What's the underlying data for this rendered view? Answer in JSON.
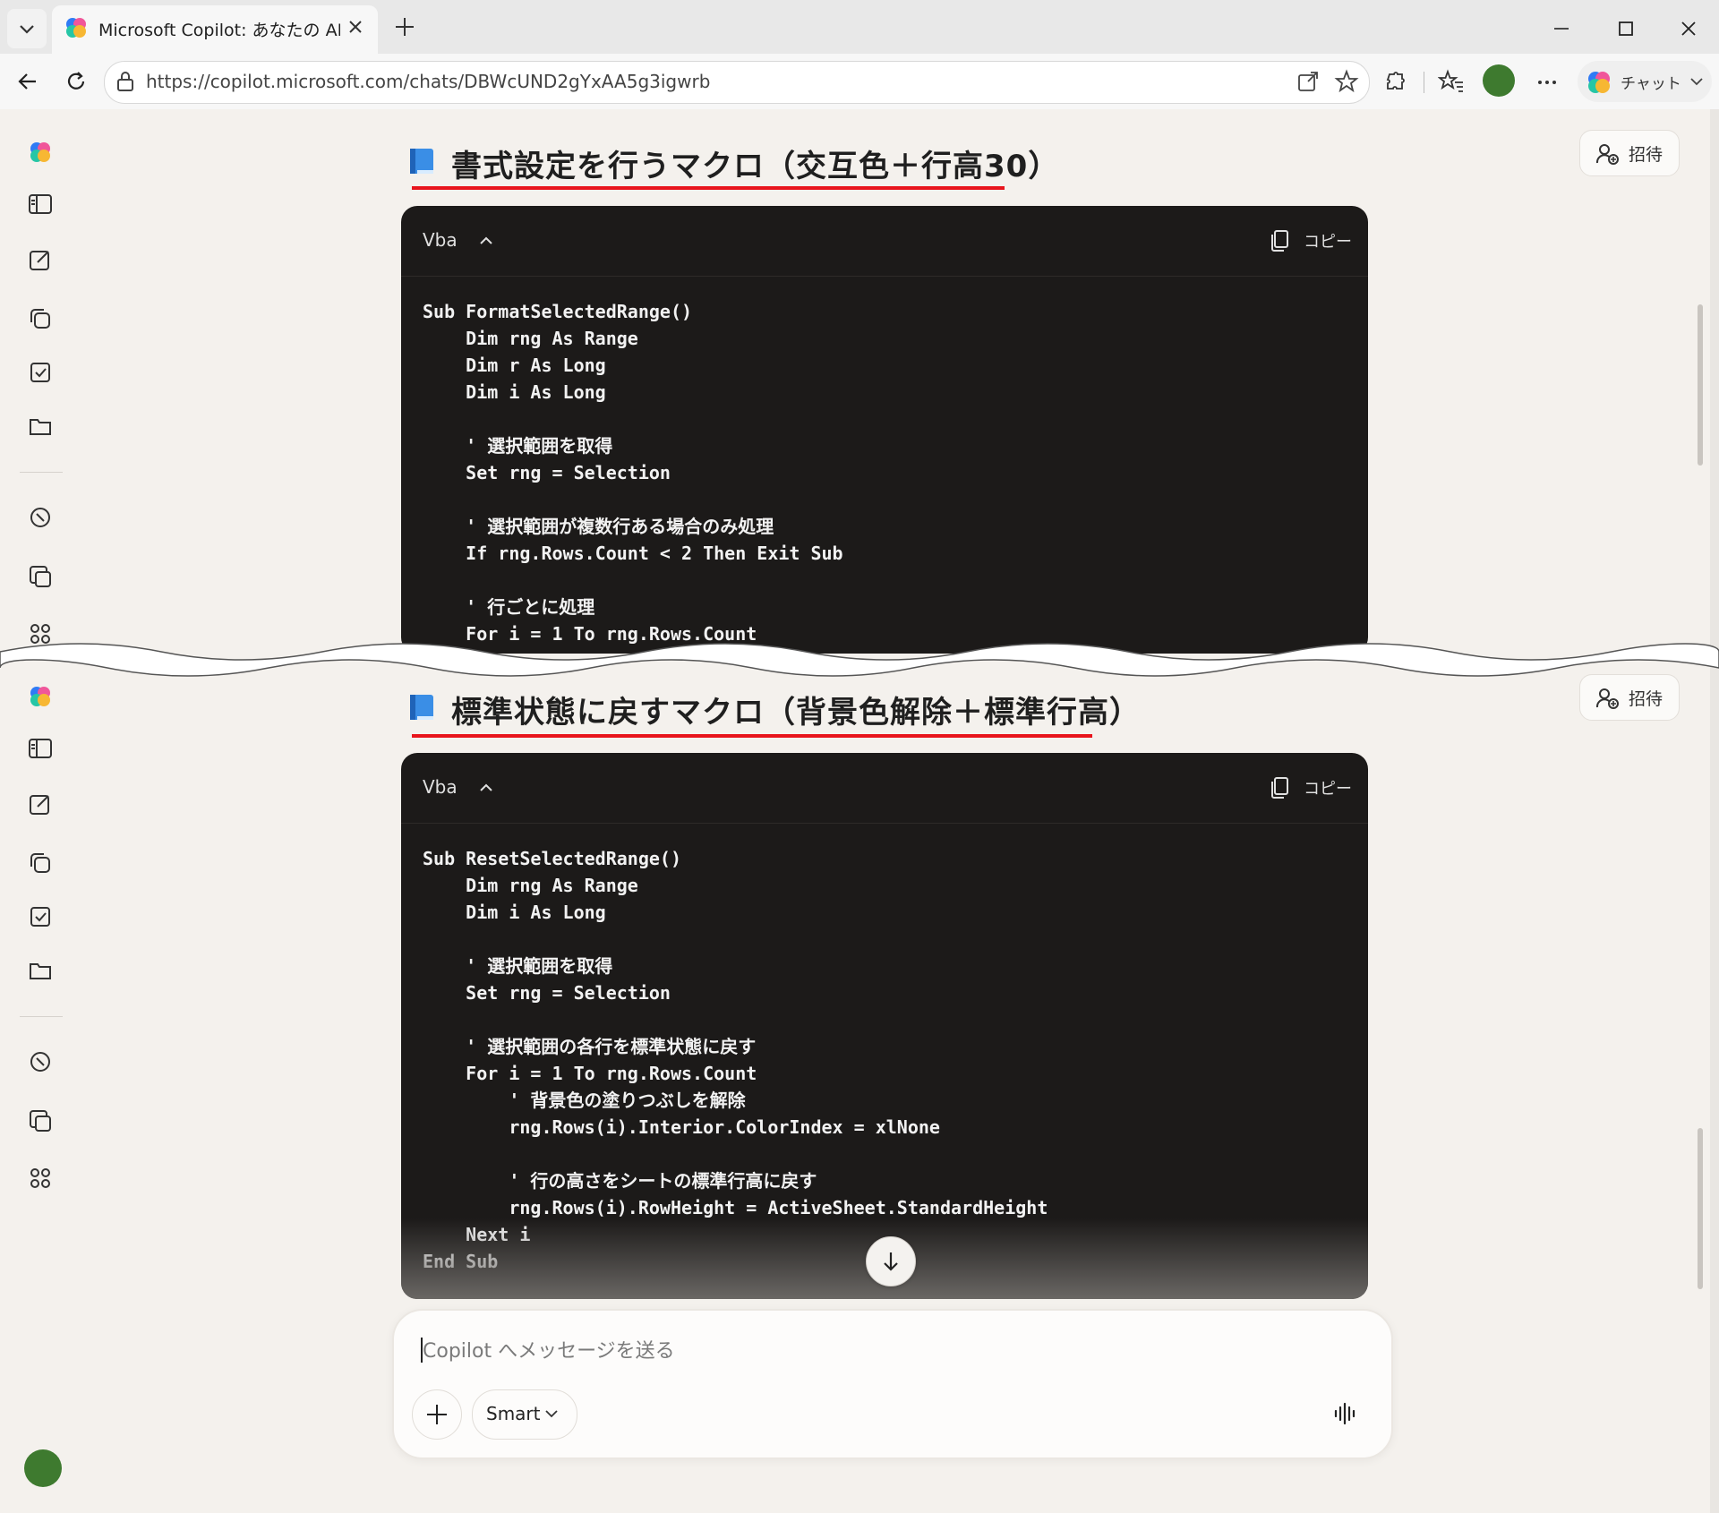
{
  "browser": {
    "tab_title": "Microsoft Copilot: あなたの AI アシス",
    "url": "https://copilot.microsoft.com/chats/DBWcUND2gYxAA5g3igwrb",
    "copilot_button_label": "チャット"
  },
  "header": {
    "invite_label": "招待"
  },
  "sections": [
    {
      "title": "書式設定を行うマクロ（交互色＋行高30）",
      "language": "Vba",
      "copy_label": "コピー",
      "code": "Sub FormatSelectedRange()\n    Dim rng As Range\n    Dim r As Long\n    Dim i As Long\n\n    ' 選択範囲を取得\n    Set rng = Selection\n\n    ' 選択範囲が複数行ある場合のみ処理\n    If rng.Rows.Count < 2 Then Exit Sub\n\n    ' 行ごとに処理\n    For i = 1 To rng.Rows.Count"
    },
    {
      "title": "標準状態に戻すマクロ（背景色解除＋標準行高）",
      "language": "Vba",
      "copy_label": "コピー",
      "code": "Sub ResetSelectedRange()\n    Dim rng As Range\n    Dim i As Long\n\n    ' 選択範囲を取得\n    Set rng = Selection\n\n    ' 選択範囲の各行を標準状態に戻す\n    For i = 1 To rng.Rows.Count\n        ' 背景色の塗りつぶしを解除\n        rng.Rows(i).Interior.ColorIndex = xlNone\n\n        ' 行の高さをシートの標準行高に戻す\n        rng.Rows(i).RowHeight = ActiveSheet.StandardHeight\n    Next i\nEnd Sub"
    }
  ],
  "composer": {
    "placeholder": "Copilot へメッセージを送る",
    "mode_label": "Smart"
  },
  "colors": {
    "title_underline": "#e8141c",
    "code_background": "#1c1a19",
    "page_background": "#f4f1ed"
  }
}
